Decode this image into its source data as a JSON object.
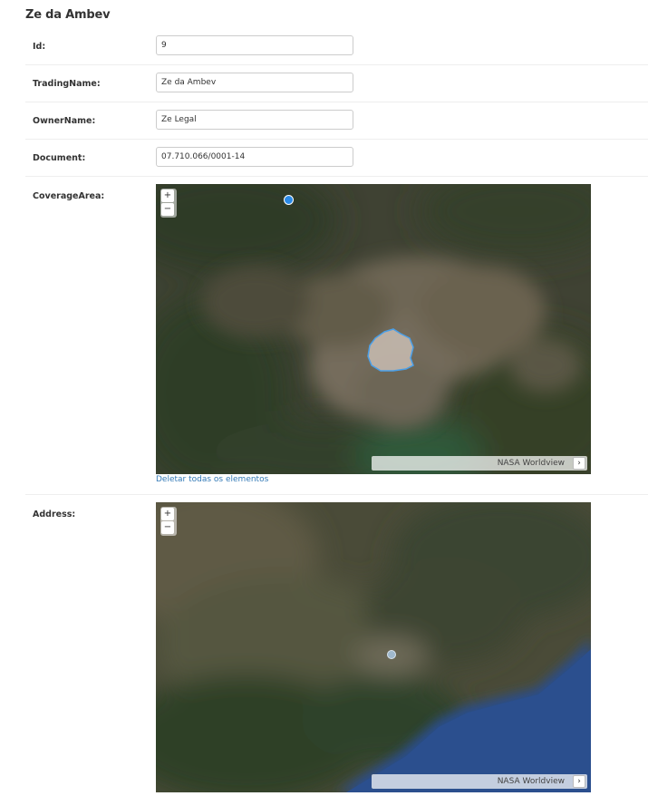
{
  "page": {
    "title": "Ze da Ambev"
  },
  "fields": [
    {
      "label": "Id:",
      "value": "9"
    },
    {
      "label": "TradingName:",
      "value": "Ze da Ambev"
    },
    {
      "label": "OwnerName:",
      "value": "Ze Legal"
    },
    {
      "label": "Document:",
      "value": "07.710.066/0001-14"
    }
  ],
  "coverage": {
    "label": "CoverageArea:",
    "zoom_in": "+",
    "zoom_out": "−",
    "attribution": "NASA Worldview",
    "attribution_toggle": "›",
    "delete_link": "Deletar todas os elementos"
  },
  "address": {
    "label": "Address:",
    "zoom_in": "+",
    "zoom_out": "−",
    "attribution": "NASA Worldview",
    "attribution_toggle": "›"
  },
  "colors": {
    "link": "#337ab7",
    "marker": "#2b8ae6",
    "polygon_stroke": "#4a9fe8",
    "ocean": "#2c4e8a"
  }
}
